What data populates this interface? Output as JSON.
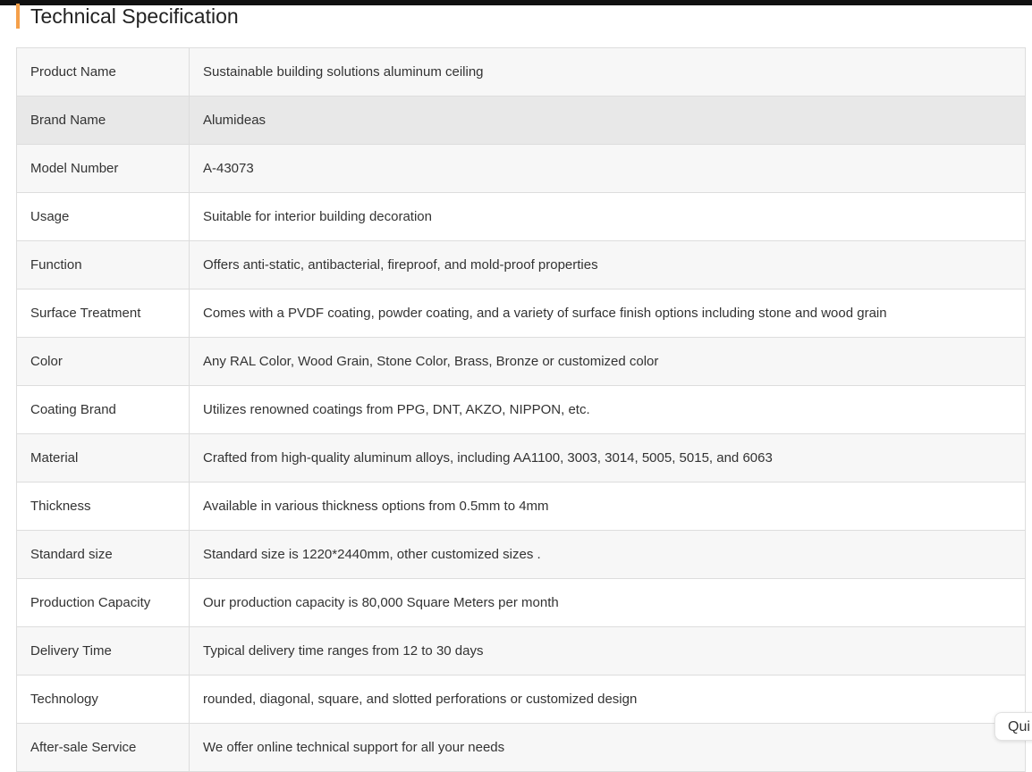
{
  "section": {
    "title": "Technical Specification",
    "accent_color": "#f5a04a"
  },
  "specs": [
    {
      "label": "Product Name",
      "value": "Sustainable building solutions aluminum ceiling"
    },
    {
      "label": "Brand Name",
      "value": "Alumideas"
    },
    {
      "label": "Model Number",
      "value": "A-43073"
    },
    {
      "label": "Usage",
      "value": "Suitable for interior building decoration"
    },
    {
      "label": "Function",
      "value": "Offers anti-static, antibacterial, fireproof, and mold-proof properties"
    },
    {
      "label": "Surface Treatment",
      "value": "Comes with a PVDF coating, powder coating, and a variety of surface finish options including stone and wood grain"
    },
    {
      "label": "Color",
      "value": "Any RAL Color, Wood Grain, Stone Color, Brass, Bronze or customized color"
    },
    {
      "label": "Coating Brand",
      "value": "Utilizes renowned coatings from PPG, DNT, AKZO, NIPPON, etc."
    },
    {
      "label": "Material",
      "value": "Crafted from high-quality aluminum alloys, including AA1100, 3003, 3014, 5005, 5015, and 6063"
    },
    {
      "label": "Thickness",
      "value": "Available in various thickness options from 0.5mm to 4mm"
    },
    {
      "label": "Standard size",
      "value": "Standard size is 1220*2440mm, other customized sizes ."
    },
    {
      "label": "Production Capacity",
      "value": "Our production capacity is 80,000 Square Meters per month"
    },
    {
      "label": "Delivery Time",
      "value": "Typical delivery time ranges from 12 to 30 days"
    },
    {
      "label": "Technology",
      "value": "rounded, diagonal, square, and slotted perforations or customized design"
    },
    {
      "label": "After-sale Service",
      "value": "We offer online technical support for all your needs"
    }
  ],
  "quick_tab": {
    "label": "Qui"
  }
}
